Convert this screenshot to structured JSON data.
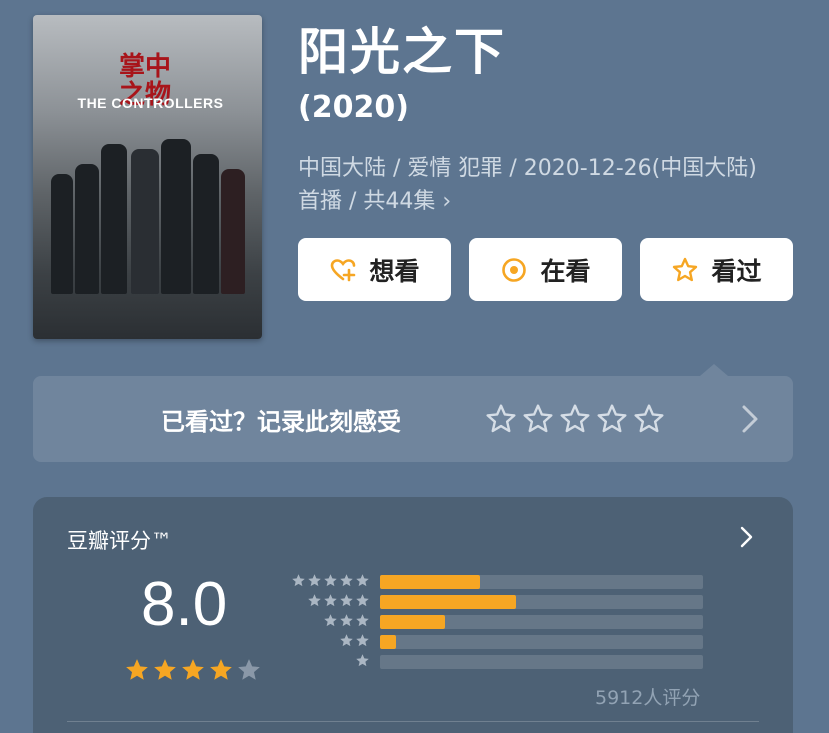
{
  "poster": {
    "cn_title": "掌中之物",
    "en_title": "THE CONTROLLERS"
  },
  "title": "阳光之下",
  "year": "(2020)",
  "meta_text": "中国大陆 / 爱情 犯罪 / 2020-12-26(中国大陆)首播 / 共44集 ›",
  "actions": [
    {
      "label": "想看",
      "icon": "heart-plus-icon"
    },
    {
      "label": "在看",
      "icon": "target-icon"
    },
    {
      "label": "看过",
      "icon": "star-icon"
    }
  ],
  "record": {
    "text": "已看过？记录此刻感受",
    "star_count": 5
  },
  "rating": {
    "label": "豆瓣评分™",
    "score": "8.0",
    "stars": 4,
    "distribution": [
      {
        "stars": 5,
        "fraction": 0.31
      },
      {
        "stars": 4,
        "fraction": 0.42
      },
      {
        "stars": 3,
        "fraction": 0.2
      },
      {
        "stars": 2,
        "fraction": 0.05
      },
      {
        "stars": 1,
        "fraction": 0.0
      }
    ],
    "count": "5912人评分"
  },
  "colors": {
    "background": "#5d7590",
    "accent": "#f6a623",
    "card": "#4d6175"
  }
}
